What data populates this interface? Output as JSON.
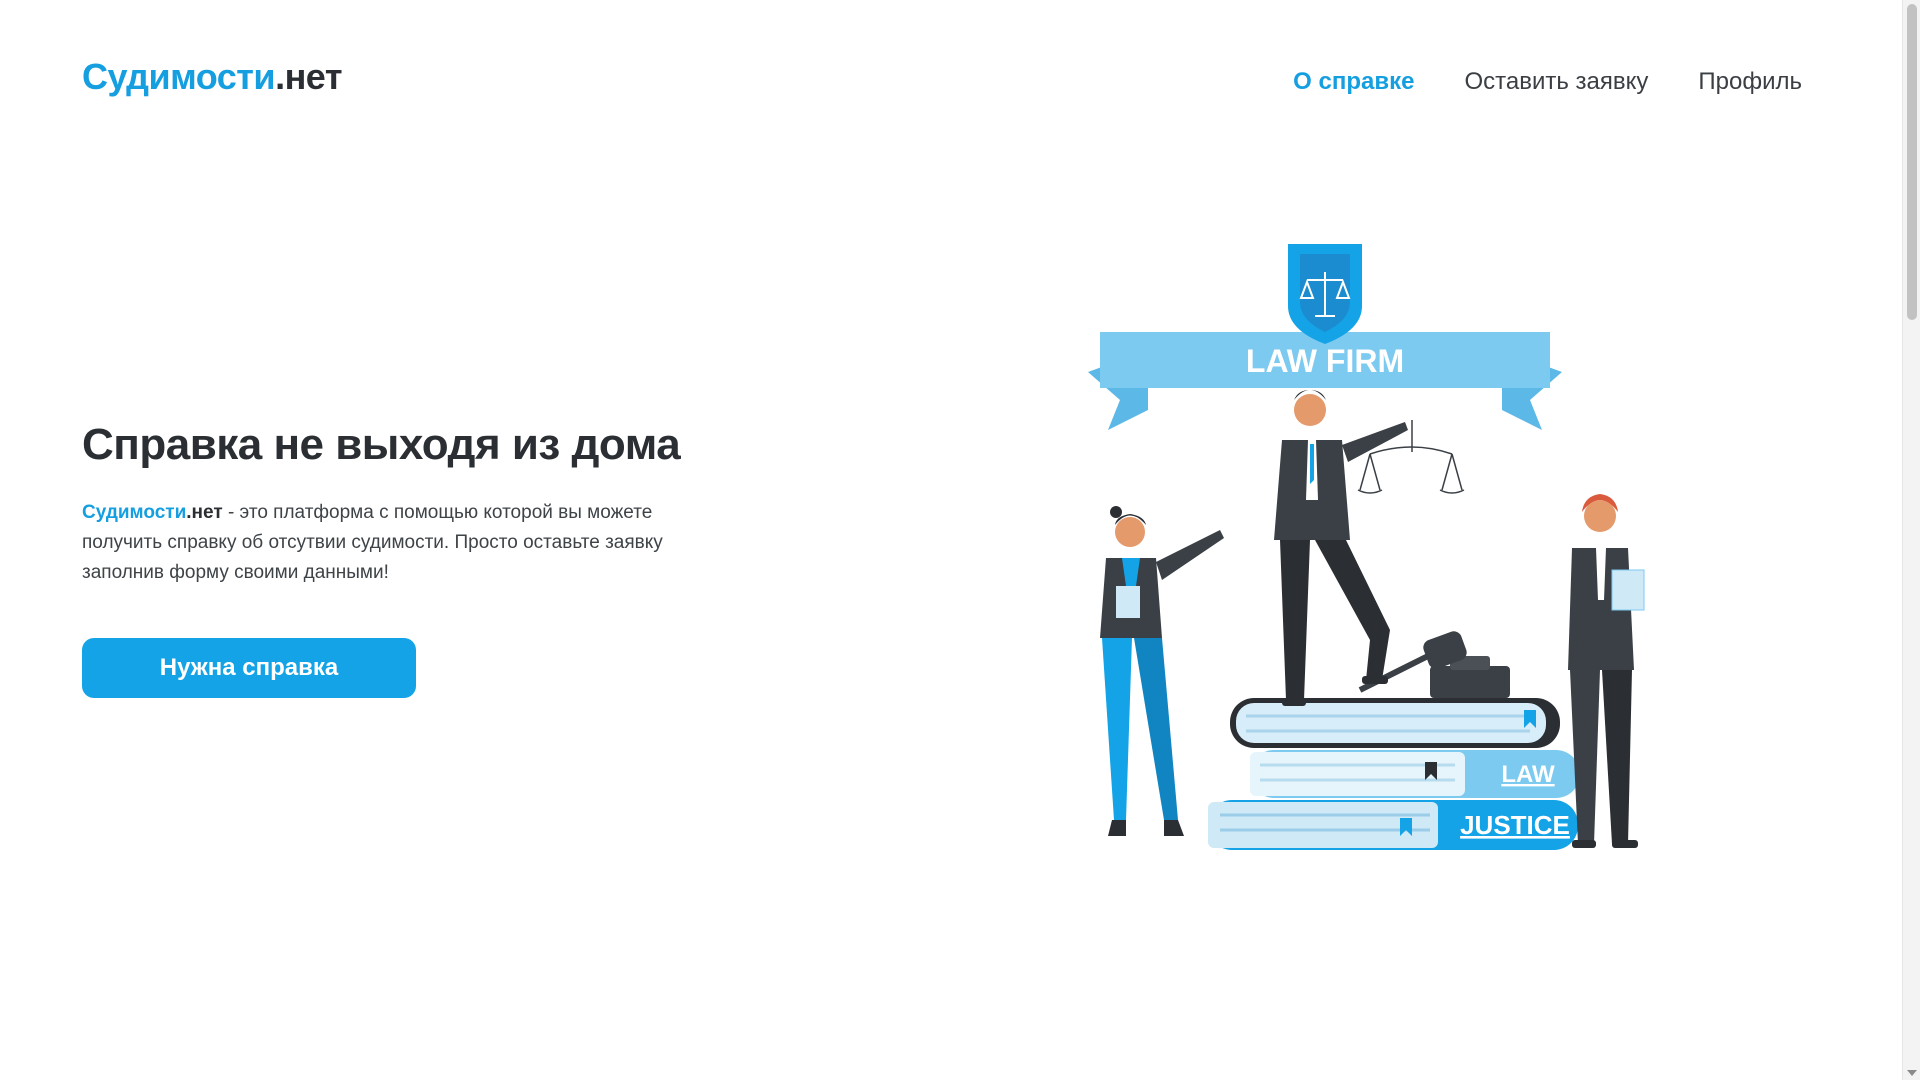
{
  "header": {
    "logo_accent": "Судимости",
    "logo_suffix": ".нет",
    "nav": [
      {
        "label": "О справке",
        "active": true
      },
      {
        "label": "Оставить заявку",
        "active": false
      },
      {
        "label": "Профиль",
        "active": false
      }
    ]
  },
  "hero": {
    "title": "Справка не выходя из дома",
    "desc_brand_accent": "Судимости",
    "desc_brand_suffix": ".нет",
    "desc_text": " - это платформа с помощью которой вы можете получить справку об отсутвии судимости. Просто оставьте заявку заполнив форму своими данными!",
    "cta_label": "Нужна справка"
  },
  "illustration": {
    "banner_text": "LAW FIRM",
    "book_label_1": "LAW",
    "book_label_2": "JUSTICE",
    "icon": "scales-of-justice-icon"
  },
  "colors": {
    "accent": "#13a3e6",
    "text_dark": "#2b2f33",
    "light_blue": "#7ccaf0",
    "suit": "#3a4046"
  }
}
